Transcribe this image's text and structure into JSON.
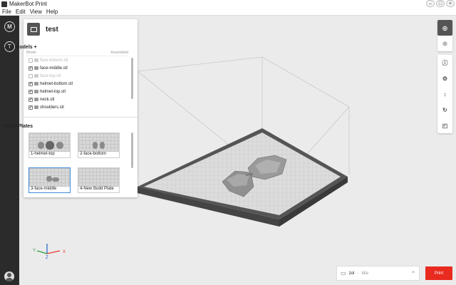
{
  "window": {
    "title": "MakerBot Print",
    "controls": [
      "–",
      "□",
      "×"
    ]
  },
  "menu": [
    "File",
    "Edit",
    "View",
    "Help"
  ],
  "leftbar": {
    "top_icons": [
      "makerbot-logo-icon",
      "thingiverse-icon"
    ],
    "bottom_icon": "user-avatar-icon"
  },
  "project": {
    "name": "test"
  },
  "models": {
    "title": "Add Models +",
    "col_model": "Model",
    "col_assembled": "Assembled",
    "items": [
      {
        "name": "face-bottom.stl",
        "checked": false
      },
      {
        "name": "face-middle.stl",
        "checked": true
      },
      {
        "name": "face-top.stl",
        "checked": false
      },
      {
        "name": "helmet-bottom.stl",
        "checked": true
      },
      {
        "name": "helmet-top.stl",
        "checked": true
      },
      {
        "name": "neck.stl",
        "checked": true
      },
      {
        "name": "shoulders.stl",
        "checked": true
      }
    ]
  },
  "build_plates": {
    "title": "Build Plates",
    "items": [
      {
        "label": "1-helmet-top",
        "selected": false
      },
      {
        "label": "2-face-bottom",
        "selected": false
      },
      {
        "label": "3-face-middle",
        "selected": true
      },
      {
        "label": "4-New Build Plate",
        "selected": false
      }
    ]
  },
  "right_toolbar": {
    "view_tools": [
      "perspective-view-icon",
      "grid-view-icon"
    ],
    "edit_tools": [
      "info-icon",
      "settings-icon",
      "move-icon",
      "rotate-icon",
      "scale-icon"
    ]
  },
  "axis": {
    "x": "X",
    "y": "Y",
    "z": "Z"
  },
  "printer": {
    "name": "zol",
    "status": "Idle"
  },
  "print_button": "Print",
  "colors": {
    "accent": "#e82a1f",
    "sidebar": "#2b2b2b",
    "selection": "#3c8ad8"
  }
}
